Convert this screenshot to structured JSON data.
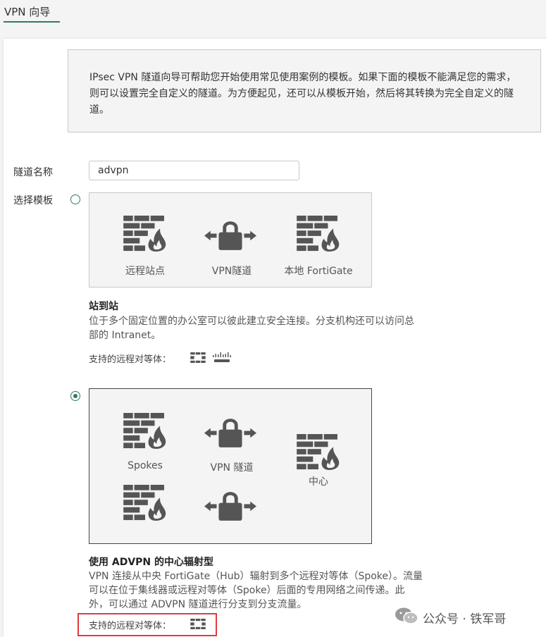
{
  "header": {
    "tab_label": "VPN 向导"
  },
  "info": {
    "text": "IPsec VPN 隧道向导可帮助您开始使用常见使用案例的模板。如果下面的模板不能满足您的需求，则可以设置完全自定义的隧道。为方便起见，还可以从模板开始，然后将其转换为完全自定义的隧道。"
  },
  "form": {
    "tunnel_name_label": "隧道名称",
    "tunnel_name_value": "advpn",
    "template_label": "选择模板"
  },
  "templates": [
    {
      "selected": false,
      "captions": [
        "远程站点",
        "VPN隧道",
        "本地 FortiGate"
      ],
      "title": "站到站",
      "desc_lines": [
        "位于多个固定位置的办公室可以彼此建立安全连接。分支机构还可以访问总",
        "部的 Intranet。"
      ],
      "peers_label": "支持的远程对等体："
    },
    {
      "selected": true,
      "captions": [
        "Spokes",
        "VPN 隧道",
        "中心"
      ],
      "title": "使用 ADVPN 的中心辐射型",
      "desc_lines": [
        "VPN 连接从中央 FortiGate（Hub）辐射到多个远程对等体（Spoke）。流量",
        "可以在位于集线器或远程对等体（Spoke）后面的专用网络之间传递。此",
        "外，可以通过 ADVPN 隧道进行分支到分支流量。"
      ],
      "peers_label": "支持的远程对等体："
    }
  ],
  "watermark": {
    "text": "公众号 · 铁军哥"
  },
  "colors": {
    "accent": "#2e7d5b",
    "icon": "#555555",
    "highlight": "#e23b3b"
  }
}
